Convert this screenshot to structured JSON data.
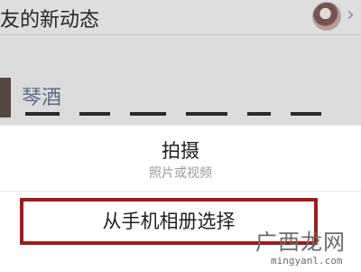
{
  "background": {
    "header": {
      "title": "友的新动态",
      "chevron": "›",
      "avatar_icon": "avatar-image"
    },
    "post": {
      "author_name": "琴酒"
    }
  },
  "sheet": {
    "capture_option": {
      "title": "拍摄",
      "subtitle": "照片或视频"
    },
    "album_option": {
      "label": "从手机相册选择"
    },
    "highlight_color": "#9e1c1c"
  },
  "watermark": {
    "mark": "广西龙网",
    "url": "mingyanl.com"
  }
}
